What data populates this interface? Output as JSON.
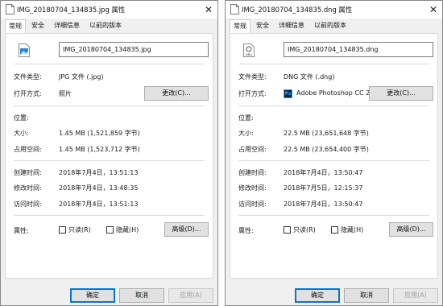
{
  "left": {
    "title": "IMG_20180704_134835.jpg 属性",
    "tabs": [
      "常规",
      "安全",
      "详细信息",
      "以前的版本"
    ],
    "file_name": "IMG_20180704_134835.jpg",
    "file_icon": "image-icon",
    "type_label": "文件类型:",
    "type_value": "JPG 文件 (.jpg)",
    "open_with_label": "打开方式:",
    "open_with_value": "照片",
    "change_button": "更改(C)...",
    "location_label": "位置:",
    "size_label": "大小:",
    "size_value": "1.45 MB (1,521,859 字节)",
    "size_on_disk_label": "占用空间:",
    "size_on_disk_value": "1.45 MB (1,523,712 字节)",
    "created_label": "创建时间:",
    "created_value": "2018年7月4日，13:51:13",
    "modified_label": "修改时间:",
    "modified_value": "2018年7月4日，13:48:35",
    "accessed_label": "访问时间:",
    "accessed_value": "2018年7月4日，13:51:13",
    "attributes_label": "属性:",
    "readonly_label": "只读(R)",
    "hidden_label": "隐藏(H)",
    "advanced_button": "高级(D)...",
    "ok_button": "确定",
    "cancel_button": "取消",
    "apply_button": "应用(A)"
  },
  "right": {
    "title": "IMG_20180704_134835.dng 属性",
    "tabs": [
      "常规",
      "安全",
      "详细信息",
      "以前的版本"
    ],
    "file_name": "IMG_20180704_134835.dng",
    "file_icon": "dng-file-icon",
    "file_icon_text": "DNG",
    "type_label": "文件类型:",
    "type_value": "DNG 文件 (.dng)",
    "open_with_label": "打开方式:",
    "open_with_icon_text": "Ps",
    "open_with_value": "Adobe Photoshop CC 2",
    "change_button": "更改(C)...",
    "location_label": "位置:",
    "size_label": "大小:",
    "size_value": "22.5 MB (23,651,648 字节)",
    "size_on_disk_label": "占用空间:",
    "size_on_disk_value": "22.5 MB (23,654,400 字节)",
    "created_label": "创建时间:",
    "created_value": "2018年7月4日，13:50:47",
    "modified_label": "修改时间:",
    "modified_value": "2018年7月5日，12:15:37",
    "accessed_label": "访问时间:",
    "accessed_value": "2018年7月4日，13:50:47",
    "attributes_label": "属性:",
    "readonly_label": "只读(R)",
    "hidden_label": "隐藏(H)",
    "advanced_button": "高级(D)...",
    "ok_button": "确定",
    "cancel_button": "取消",
    "apply_button": "应用(A)"
  },
  "close_glyph": "✕",
  "colors": {
    "dialog_bg": "#f0f0f0",
    "panel_bg": "#ffffff",
    "accent": "#0078d7",
    "photoshop_bg": "#001d34",
    "photoshop_fg": "#31a8ff"
  }
}
